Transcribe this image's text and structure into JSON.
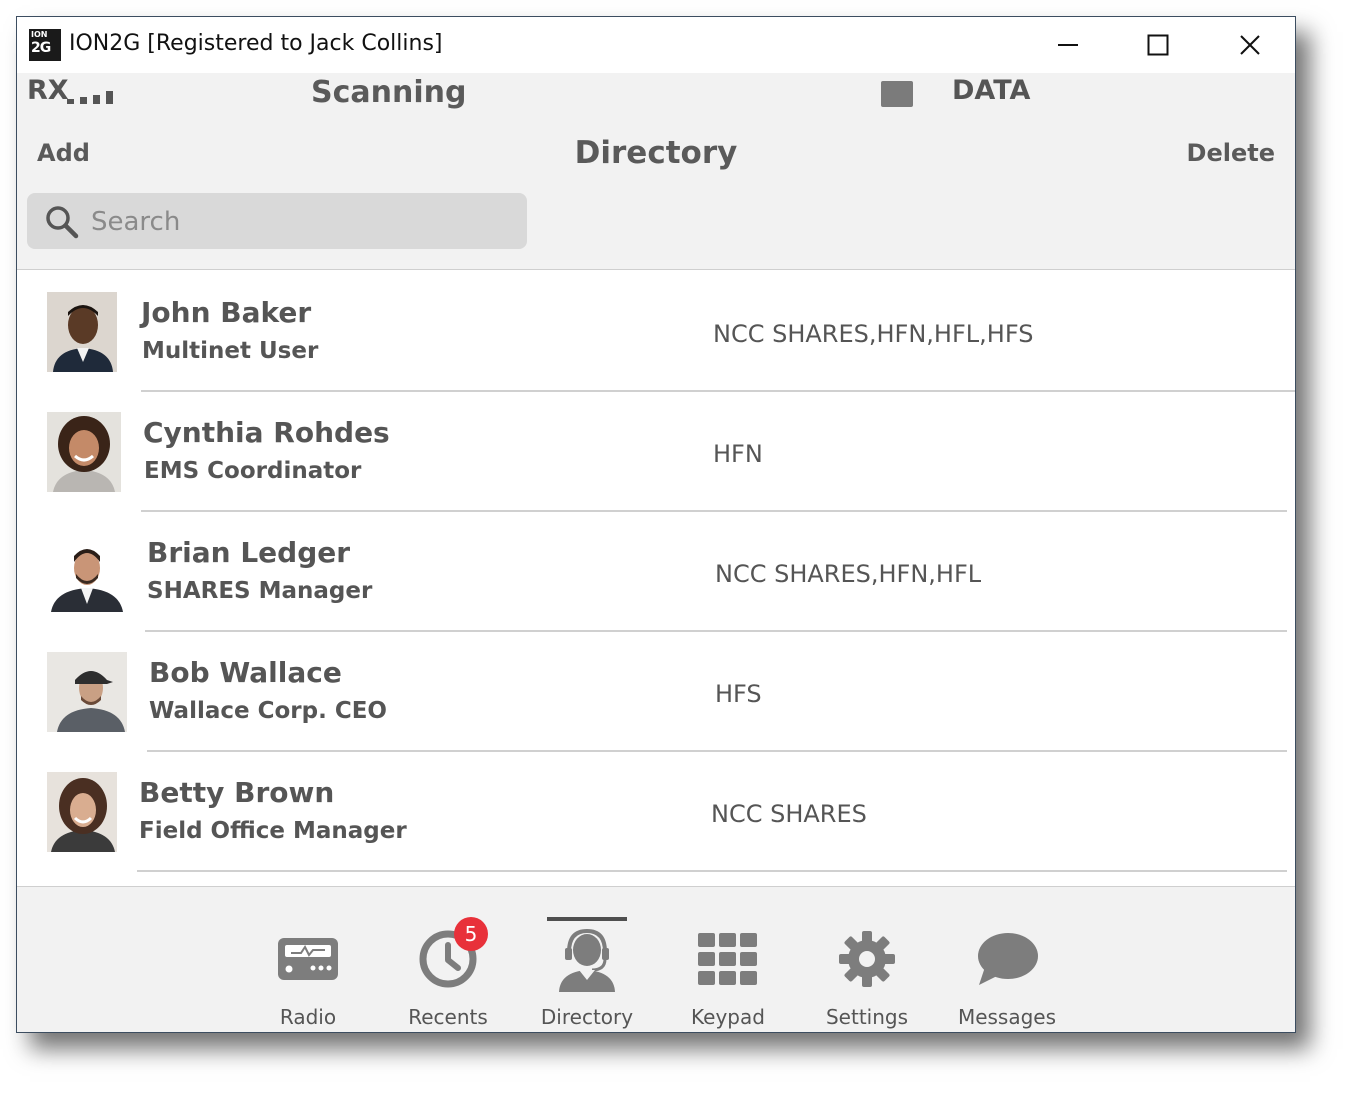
{
  "window": {
    "title": "ION2G [Registered to Jack Collins]",
    "logo_top": "ION",
    "logo_bottom": "2G"
  },
  "status": {
    "rx_label": "RX",
    "mode": "Scanning",
    "data_label": "DATA"
  },
  "toolbar": {
    "add_label": "Add",
    "title": "Directory",
    "delete_label": "Delete"
  },
  "search": {
    "placeholder": "Search"
  },
  "contacts": [
    {
      "name": "John Baker",
      "role": "Multinet User",
      "groups": "NCC SHARES,HFN,HFL,HFS"
    },
    {
      "name": "Cynthia Rohdes",
      "role": "EMS Coordinator",
      "groups": "HFN"
    },
    {
      "name": "Brian Ledger",
      "role": "SHARES Manager",
      "groups": "NCC SHARES,HFN,HFL"
    },
    {
      "name": "Bob Wallace",
      "role": "Wallace Corp. CEO",
      "groups": "HFS"
    },
    {
      "name": "Betty Brown",
      "role": "Field Office Manager",
      "groups": "NCC SHARES"
    }
  ],
  "nav": {
    "items": [
      {
        "label": "Radio",
        "icon": "radio-icon"
      },
      {
        "label": "Recents",
        "icon": "clock-icon",
        "badge": "5"
      },
      {
        "label": "Directory",
        "icon": "headset-user-icon",
        "active": true
      },
      {
        "label": "Keypad",
        "icon": "keypad-icon"
      },
      {
        "label": "Settings",
        "icon": "gear-icon"
      },
      {
        "label": "Messages",
        "icon": "chat-bubble-icon"
      }
    ]
  },
  "colors": {
    "badge": "#e8313a",
    "text": "#555555",
    "background": "#f2f2f2",
    "border": "#3c4d60"
  }
}
